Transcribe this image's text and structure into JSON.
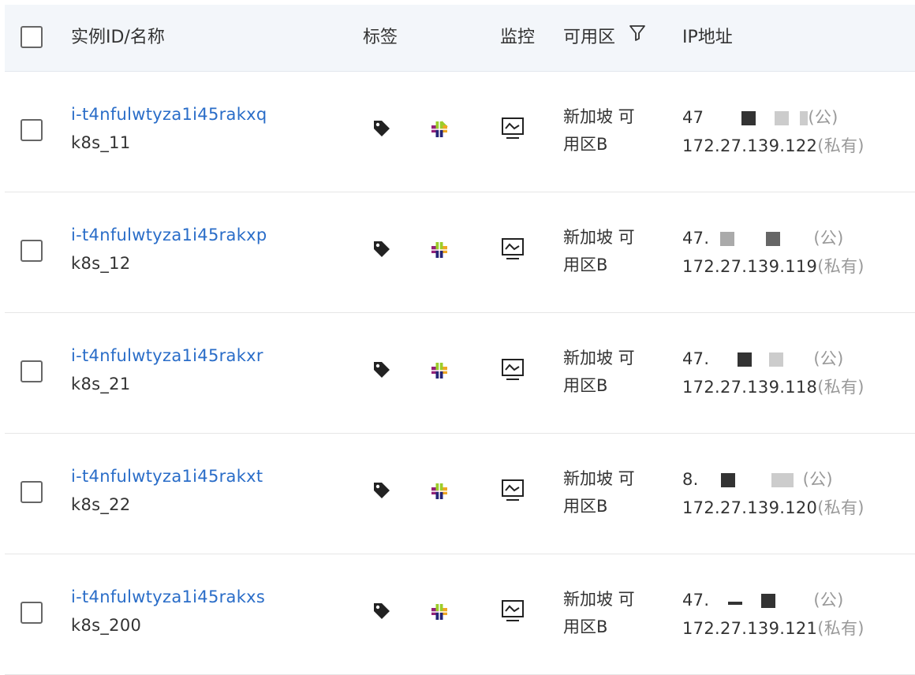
{
  "header": {
    "col_instance": "实例ID/名称",
    "col_tags": "标签",
    "col_monitor": "监控",
    "col_zone": "可用区",
    "col_ip": "IP地址"
  },
  "icons": {
    "filter": "filter-icon",
    "tag": "tag-icon",
    "os": "centos-icon",
    "monitor": "monitor-icon"
  },
  "colors": {
    "link": "#2a6dc8",
    "header_bg": "#f3f6fa",
    "muted": "#999999"
  },
  "rows": [
    {
      "id": "i-t4nfulwtyza1i45rakxq",
      "name": "k8s_11",
      "zone_line1": "新加坡 可",
      "zone_line2": "用区B",
      "public_ip_prefix": "47",
      "public_suffix": "(公)",
      "private_ip": "172.27.139.122",
      "private_suffix": "(私有)"
    },
    {
      "id": "i-t4nfulwtyza1i45rakxp",
      "name": "k8s_12",
      "zone_line1": "新加坡 可",
      "zone_line2": "用区B",
      "public_ip_prefix": "47.",
      "public_suffix": "(公)",
      "private_ip": "172.27.139.119",
      "private_suffix": "(私有)"
    },
    {
      "id": "i-t4nfulwtyza1i45rakxr",
      "name": "k8s_21",
      "zone_line1": "新加坡 可",
      "zone_line2": "用区B",
      "public_ip_prefix": "47.",
      "public_suffix": "(公)",
      "private_ip": "172.27.139.118",
      "private_suffix": "(私有)"
    },
    {
      "id": "i-t4nfulwtyza1i45rakxt",
      "name": "k8s_22",
      "zone_line1": "新加坡 可",
      "zone_line2": "用区B",
      "public_ip_prefix": "8.",
      "public_suffix": "(公)",
      "private_ip": "172.27.139.120",
      "private_suffix": "(私有)"
    },
    {
      "id": "i-t4nfulwtyza1i45rakxs",
      "name": "k8s_200",
      "zone_line1": "新加坡 可",
      "zone_line2": "用区B",
      "public_ip_prefix": "47.",
      "public_suffix": "(公)",
      "private_ip": "172.27.139.121",
      "private_suffix": "(私有)"
    }
  ]
}
